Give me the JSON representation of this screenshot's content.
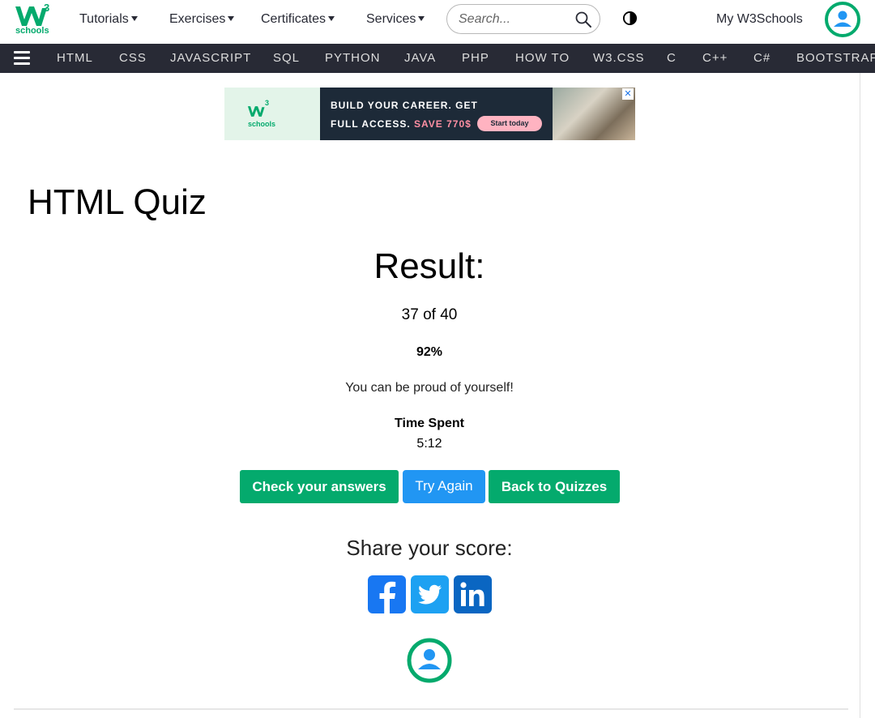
{
  "header": {
    "logo_sup": "3",
    "logo_sub": "schools",
    "menus": [
      "Tutorials",
      "Exercises",
      "Certificates",
      "Services"
    ],
    "search_placeholder": "Search...",
    "my_account": "My W3Schools"
  },
  "subnav": {
    "items": [
      "HTML",
      "CSS",
      "JAVASCRIPT",
      "SQL",
      "PYTHON",
      "JAVA",
      "PHP",
      "HOW TO",
      "W3.CSS",
      "C",
      "C++",
      "C#",
      "BOOTSTRAP"
    ]
  },
  "ad": {
    "logo_sup": "3",
    "logo_sub": "schools",
    "line1": "BUILD YOUR CAREER. GET",
    "line2_start": "FULL ACCESS.",
    "line2_save": "SAVE 770$",
    "cta": "Start today",
    "close": "✕"
  },
  "main": {
    "title": "HTML Quiz",
    "result_heading": "Result:",
    "score": "37 of 40",
    "percent": "92%",
    "message": "You can be proud of yourself!",
    "time_label": "Time Spent",
    "time_value": "5:12",
    "buttons": {
      "check": "Check your answers",
      "try": "Try Again",
      "back": "Back to Quizzes"
    },
    "share_heading": "Share your score:"
  },
  "colors": {
    "brand_green": "#04AA6D",
    "nav_dark": "#282A35",
    "try_blue": "#2196F3",
    "facebook": "#1877F2",
    "twitter": "#1DA1F2",
    "linkedin": "#0A66C2"
  },
  "icons": {
    "search": "search-icon",
    "contrast": "contrast-icon",
    "menu": "hamburger-menu-icon",
    "user": "user-avatar-icon",
    "facebook": "facebook-icon",
    "twitter": "twitter-icon",
    "linkedin": "linkedin-icon"
  }
}
